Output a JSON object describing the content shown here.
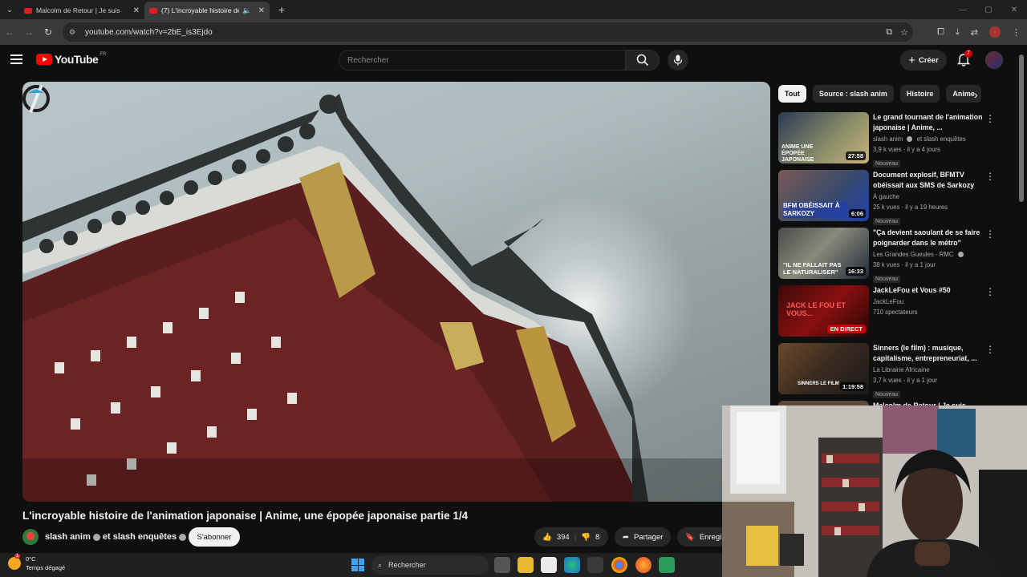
{
  "browser": {
    "tabs": [
      {
        "title": "Malcolm de Retour | Je suis",
        "active": false
      },
      {
        "title": "(7) L'incroyable histoire de",
        "active": true
      }
    ],
    "url": "youtube.com/watch?v=2bE_is3Ejdo"
  },
  "header": {
    "logo_text": "YouTube",
    "country": "FR",
    "search_placeholder": "Rechercher",
    "create_label": "Créer",
    "notif_count": "7"
  },
  "video": {
    "title": "L'incroyable histoire de l'animation japonaise | Anime, une épopée japonaise partie 1/4",
    "channel": "slash anim",
    "channel_joint": "et slash enquêtes",
    "subscribe_label": "S'abonner",
    "likes": "394",
    "dislikes": "8",
    "share_label": "Partager",
    "save_label": "Enregi"
  },
  "chips": [
    "Tout",
    "Source : slash anim",
    "Histoire",
    "Anime"
  ],
  "recommendations": [
    {
      "title": "Le grand tournant de l'animation japonaise | Anime, ...",
      "channel": "slash anim",
      "channel_extra": "et slash enquêtes",
      "views": "3,9 k vues · il y a 4 jours",
      "badge": "Nouveau",
      "duration": "27:58",
      "thumb_text": "ANIME UNE ÉPOPÉE JAPONAISE"
    },
    {
      "title": "Document explosif, BFMTV obéissait aux SMS de Sarkozy",
      "channel": "À gauche",
      "channel_extra": "",
      "views": "25 k vues · il y a 19 heures",
      "badge": "Nouveau",
      "duration": "6:06",
      "thumb_text": "BFM OBÉISSAIT À SARKOZY"
    },
    {
      "title": "\"Ça devient saoulant de se faire poignarder dans le métro\"",
      "channel": "Les Grandes Gueules - RMC",
      "channel_extra": "",
      "views": "38 k vues · il y a 1 jour",
      "badge": "Nouveau",
      "duration": "16:33",
      "thumb_text": "\"IL NE FALLAIT PAS LE NATURALISER\""
    },
    {
      "title": "JackLeFou et Vous #50",
      "channel": "JackLeFou",
      "channel_extra": "",
      "views": "710 spectateurs",
      "badge": "",
      "duration": "EN DIRECT",
      "thumb_text": "JACK LE FOU ET VOUS..."
    },
    {
      "title": "Sinners (le film) : musique, capitalisme, entrepreneuriat, ...",
      "channel": "La Librairie Africaine",
      "channel_extra": "",
      "views": "3,7 k vues · il y a 1 jour",
      "badge": "Nouveau",
      "duration": "1:19:58",
      "thumb_text": "SINNERS LE FILM"
    },
    {
      "title": "Malcolm de Retour | Je suis",
      "channel": "",
      "channel_extra": "",
      "views": "",
      "badge": "",
      "duration": "",
      "thumb_text": ""
    }
  ],
  "taskbar": {
    "temperature": "0°C",
    "weather": "Temps dégagé",
    "weather_badge": "1",
    "search_label": "Rechercher"
  },
  "colors": {
    "yt_red": "#ff0000",
    "bg": "#0f0f0f",
    "chip_bg": "#272727"
  }
}
